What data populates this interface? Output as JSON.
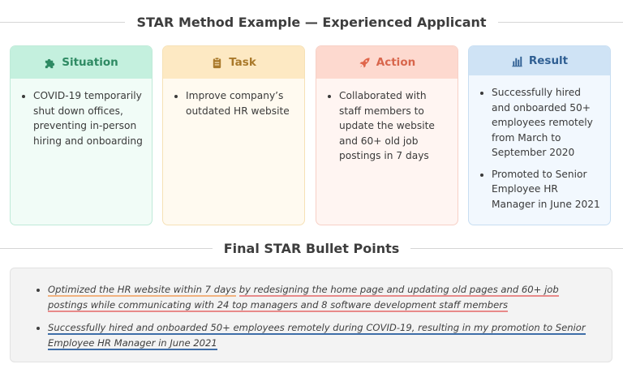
{
  "header": {
    "title": "STAR Method Example — Experienced Applicant"
  },
  "cards": {
    "situation": {
      "label": "Situation",
      "icon": "puzzle-icon",
      "color": "#2e8a63",
      "items": [
        "COVID-19 temporarily shut down offices, preventing in-person hiring and onboarding"
      ]
    },
    "task": {
      "label": "Task",
      "icon": "clipboard-icon",
      "color": "#a9792a",
      "items": [
        "Improve company’s outdated HR website"
      ]
    },
    "action": {
      "label": "Action",
      "icon": "rocket-icon",
      "color": "#d8664c",
      "items": [
        "Collaborated with staff members to update the website and 60+ old job postings in 7 days"
      ]
    },
    "result": {
      "label": "Result",
      "icon": "bar-chart-icon",
      "color": "#2f5f93",
      "items": [
        "Successfully hired and onboarded 50+ employees remotely from March to September 2020",
        "Promoted to Senior Employee HR Manager in June 2021"
      ]
    }
  },
  "final": {
    "title": "Final STAR Bullet Points",
    "bullet1": {
      "part1": "Optimized the HR website within 7 days",
      "part2": "by redesigning the home page and updating old pages and 60+ job postings while communicating with 24 top managers and 8 software development staff members"
    },
    "bullet2": {
      "text": "Successfully hired and onboarded 50+ employees remotely during COVID-19, resulting in my promotion to Senior Employee HR Manager in June 2021"
    }
  }
}
